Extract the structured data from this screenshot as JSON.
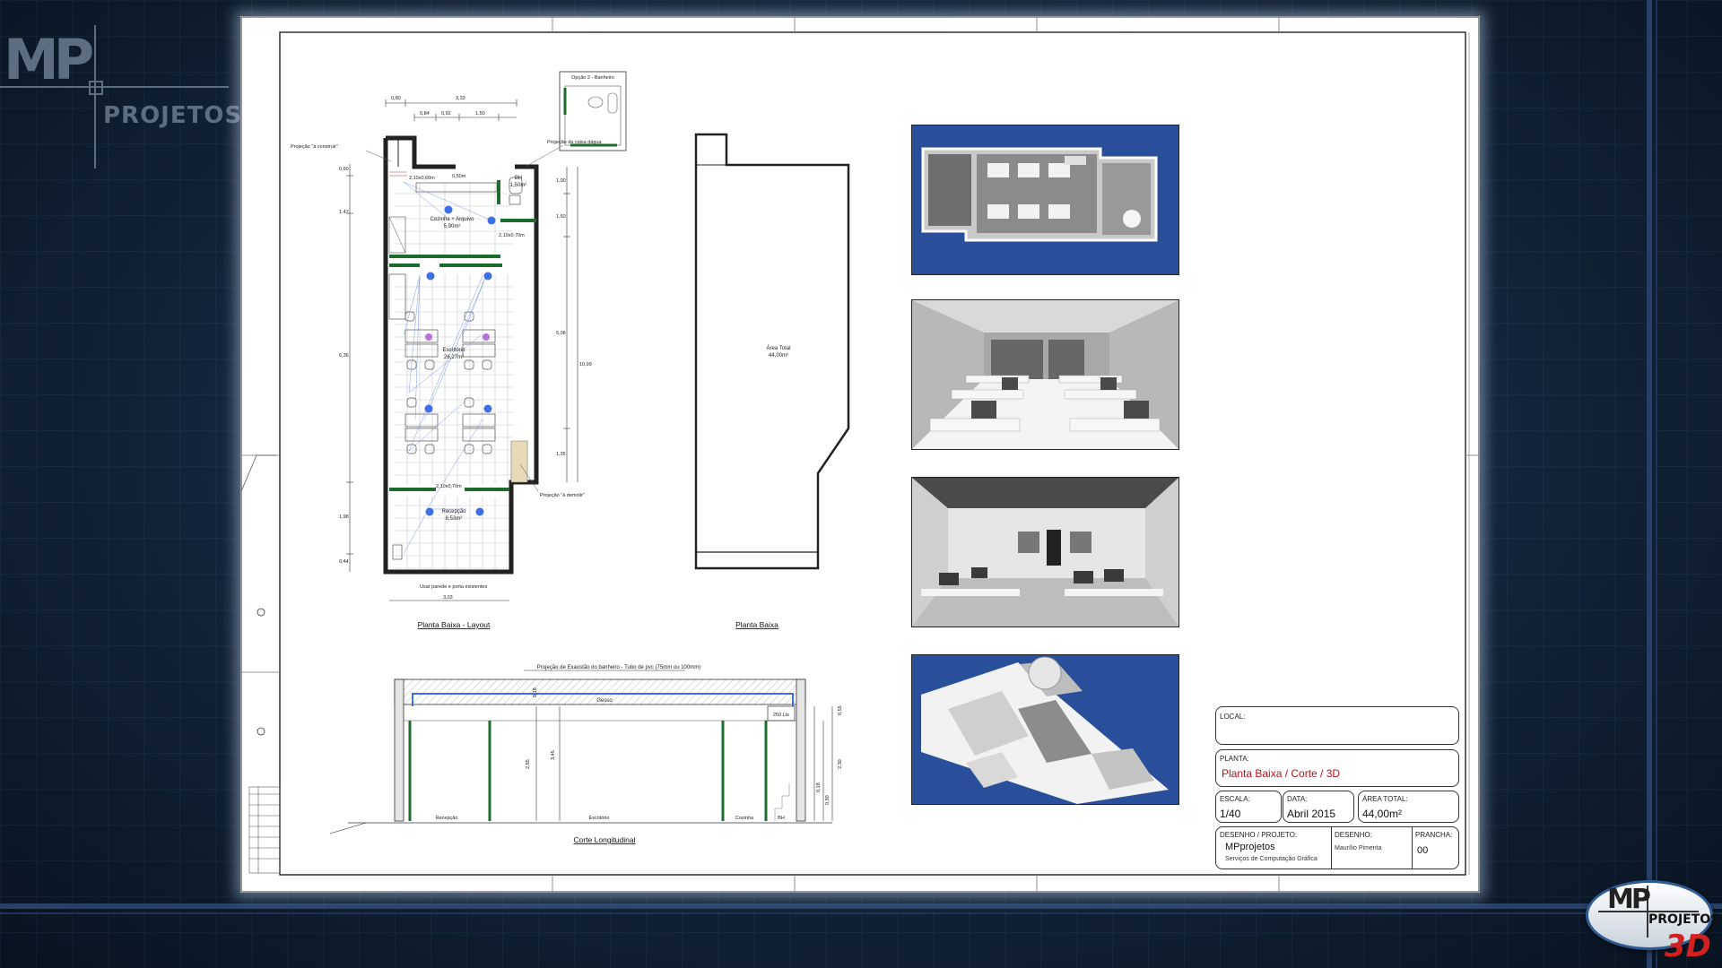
{
  "logos": {
    "top_left": {
      "mp": "MP",
      "projetos": "PROJETOS"
    },
    "bottom_right": {
      "mp": "MP",
      "projetos": "PROJETOS",
      "three_d": "3D"
    }
  },
  "floorplan": {
    "title": "Planta Baixa - Layout",
    "rooms": {
      "kitchen_name": "Cozinha + Arquivo",
      "kitchen_area": "5,90m²",
      "office_name": "Escritório",
      "office_area": "26,27m²",
      "reception_name": "Recepção",
      "reception_area": "8,53m²",
      "wc_name": "BH",
      "wc_area": "1,50m²"
    },
    "notes": {
      "bathroom_option": "Opção 2 - Banheiro",
      "build_projection": "Projeção \"à construir\"",
      "water_tank": "Projeção da caixa dágua",
      "demolish_projection": "Projeção \"à demolir\"",
      "existing_wall": "Usar parede e porta existentes"
    },
    "dims": {
      "top_1": "0,80",
      "top_2": "3,33",
      "top_3": "0,84",
      "top_4": "0,92",
      "top_5": "1,50",
      "left_1": "0,60",
      "left_2": "1,47",
      "left_3": "6,36",
      "left_4": "1,98",
      "left_5": "0,44",
      "right_1": "1,00",
      "right_2": "1,60",
      "right_3": "5,08",
      "right_4": "10,99",
      "right_5": "1,35",
      "bottom": "3,03"
    },
    "tags": {
      "t1": "2,10x0,60m",
      "t2": "2,10x0,70m",
      "t3": "2,10x0,70m",
      "t4": "0,50m"
    }
  },
  "plan": {
    "title": "Planta Baixa",
    "area_label": "Área Total",
    "area_value": "44,00m²"
  },
  "section": {
    "title": "Corte Longitudinal",
    "note": "Projeção de Exaustão do banheiro - Tubo de pvc (75mm ou 100mm)",
    "gesso": "Gesso",
    "tank": "250 Lts",
    "rooms": [
      "Recepção",
      "Escritório",
      "Cozinha",
      "BH"
    ],
    "dims": {
      "h1": "2,85",
      "h2": "3,45",
      "h3": "0,18",
      "r1": "0,55",
      "r2": "2,30",
      "r3": "0,90",
      "r4": "0,18"
    }
  },
  "title_block": {
    "local_label": "LOCAL:",
    "planta_label": "PLANTA:",
    "planta_value": "Planta Baixa / Corte / 3D",
    "escala_label": "ESCALA:",
    "escala_value": "1/40",
    "data_label": "DATA:",
    "data_value": "Abril 2015",
    "area_label": "ÁREA TOTAL:",
    "area_value": "44,00m²",
    "projeto_label": "DESENHO / PROJETO:",
    "projeto_value": "MPprojetos",
    "projeto_sub": "Serviços de Computação Gráfica",
    "desenho_label": "DESENHO:",
    "desenho_value": "Maurílio Pimenta",
    "prancha_label": "PRANCHA:",
    "prancha_value": "00"
  },
  "colors": {
    "blue_bg": "#2a4f9a",
    "wall_green": "#1e6b2e",
    "dot_blue": "#3f6fe6",
    "title_red": "#b0141b"
  }
}
